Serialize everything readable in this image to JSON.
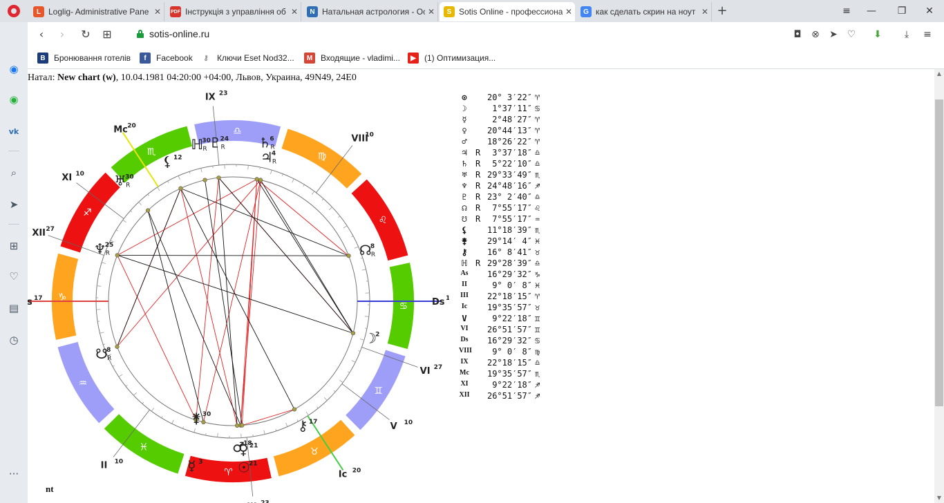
{
  "browser": {
    "tabs": [
      {
        "title": "Loglig- Administrative Pane",
        "favicon": "L",
        "color": "#e8572c"
      },
      {
        "title": "Інструкція з управління об",
        "favicon": "PDF",
        "color": "#d9342b"
      },
      {
        "title": "Натальная астрология - Ос",
        "favicon": "N",
        "color": "#2f6db5"
      },
      {
        "title": "Sotis Online - профессиона",
        "favicon": "S",
        "color": "#e6b800",
        "active": true
      },
      {
        "title": "как сделать скрин на ноут",
        "favicon": "G",
        "color": "#4285f4"
      }
    ],
    "url": "sotis-online.ru",
    "bookmarks": [
      {
        "label": "Бронювання готелів",
        "icon": "B",
        "color": "#1c3d7a"
      },
      {
        "label": "Facebook",
        "icon": "f",
        "color": "#3b5998"
      },
      {
        "label": "Ключи Eset Nod32...",
        "icon": "key",
        "color": "#888888"
      },
      {
        "label": "Входящие - vladimi...",
        "icon": "M",
        "color": "#d44638"
      },
      {
        "label": "(1) Оптимизация...",
        "icon": "yt",
        "color": "#e62117"
      }
    ]
  },
  "header": {
    "prefix": "Натал: ",
    "chart_name": "New chart (w)",
    "details": ", 10.04.1981 04:20:00 +04:00, Львов, Украина, 49N49, 24E0"
  },
  "wheel": {
    "houses": [
      {
        "label": "As",
        "deg": "17"
      },
      {
        "label": "II",
        "deg": "10"
      },
      {
        "label": "III",
        "deg": "23"
      },
      {
        "label": "Ic",
        "deg": "20"
      },
      {
        "label": "V",
        "deg": "10"
      },
      {
        "label": "VI",
        "deg": "27"
      },
      {
        "label": "Ds",
        "deg": "17"
      },
      {
        "label": "VIII",
        "deg": "10"
      },
      {
        "label": "IX",
        "deg": "23"
      },
      {
        "label": "Mc",
        "deg": "20"
      },
      {
        "label": "XI",
        "deg": "10"
      },
      {
        "label": "XII",
        "deg": "27"
      }
    ],
    "planets": [
      {
        "glyph": "☉",
        "deg": "21",
        "retro": ""
      },
      {
        "glyph": "☽",
        "deg": "2",
        "retro": ""
      },
      {
        "glyph": "☿",
        "deg": "3",
        "retro": ""
      },
      {
        "glyph": "♀",
        "deg": "21",
        "retro": ""
      },
      {
        "glyph": "♂",
        "deg": "18",
        "retro": ""
      },
      {
        "glyph": "♃",
        "deg": "4",
        "retro": "R"
      },
      {
        "glyph": "♄",
        "deg": "6",
        "retro": "R"
      },
      {
        "glyph": "♅",
        "deg": "30",
        "retro": "R"
      },
      {
        "glyph": "♆",
        "deg": "25",
        "retro": "R"
      },
      {
        "glyph": "♇",
        "deg": "24",
        "retro": "R"
      },
      {
        "glyph": "☊",
        "deg": "8",
        "retro": "R"
      },
      {
        "glyph": "☋",
        "deg": "8",
        "retro": "R"
      },
      {
        "glyph": "⚸",
        "deg": "12",
        "retro": ""
      },
      {
        "glyph": "⚵",
        "deg": "30",
        "retro": ""
      },
      {
        "glyph": "⚷",
        "deg": "17",
        "retro": ""
      },
      {
        "glyph": "ℍ",
        "deg": "30",
        "retro": "R"
      }
    ]
  },
  "table": [
    {
      "sym": "⊙",
      "rx": "",
      "deg": "20° 3′22″",
      "sign": "♈"
    },
    {
      "sym": "☽",
      "rx": "",
      "deg": "1°37′11″",
      "sign": "♋"
    },
    {
      "sym": "☿",
      "rx": "",
      "deg": "2°48′27″",
      "sign": "♈"
    },
    {
      "sym": "♀",
      "rx": "",
      "deg": "20°44′13″",
      "sign": "♈"
    },
    {
      "sym": "♂",
      "rx": "",
      "deg": "18°26′22″",
      "sign": "♈"
    },
    {
      "sym": "♃",
      "rx": "R",
      "deg": "3°37′18″",
      "sign": "♎"
    },
    {
      "sym": "♄",
      "rx": "R",
      "deg": "5°22′10″",
      "sign": "♎"
    },
    {
      "sym": "♅",
      "rx": "R",
      "deg": "29°33′49″",
      "sign": "♏"
    },
    {
      "sym": "♆",
      "rx": "R",
      "deg": "24°48′16″",
      "sign": "♐"
    },
    {
      "sym": "♇",
      "rx": "R",
      "deg": "23° 2′40″",
      "sign": "♎"
    },
    {
      "sym": "☊",
      "rx": "R",
      "deg": "7°55′17″",
      "sign": "♌"
    },
    {
      "sym": "☋",
      "rx": "R",
      "deg": "7°55′17″",
      "sign": "♒"
    },
    {
      "sym": "⚸",
      "rx": "",
      "deg": "11°18′39″",
      "sign": "♏"
    },
    {
      "sym": "⚵",
      "rx": "",
      "deg": "29°14′ 4″",
      "sign": "♓"
    },
    {
      "sym": "⚷",
      "rx": "",
      "deg": "16° 8′41″",
      "sign": "♉"
    },
    {
      "sym": "ℍ",
      "rx": "R",
      "deg": "29°28′39″",
      "sign": "♎"
    },
    {
      "sym": "As",
      "rx": "",
      "deg": "16°29′32″",
      "sign": "♑"
    },
    {
      "sym": "II",
      "rx": "",
      "deg": "9° 0′ 8″",
      "sign": "♓"
    },
    {
      "sym": "III",
      "rx": "",
      "deg": "22°18′15″",
      "sign": "♈"
    },
    {
      "sym": "Ic",
      "rx": "",
      "deg": "19°35′57″",
      "sign": "♉"
    },
    {
      "sym": "V",
      "rx": "",
      "deg": "9°22′18″",
      "sign": "♊"
    },
    {
      "sym": "VI",
      "rx": "",
      "deg": "26°51′57″",
      "sign": "♊"
    },
    {
      "sym": "Ds",
      "rx": "",
      "deg": "16°29′32″",
      "sign": "♋"
    },
    {
      "sym": "VIII",
      "rx": "",
      "deg": "9° 0′ 8″",
      "sign": "♍"
    },
    {
      "sym": "IX",
      "rx": "",
      "deg": "22°18′15″",
      "sign": "♎"
    },
    {
      "sym": "Mc",
      "rx": "",
      "deg": "19°35′57″",
      "sign": "♏"
    },
    {
      "sym": "XI",
      "rx": "",
      "deg": "9°22′18″",
      "sign": "♐"
    },
    {
      "sym": "XII",
      "rx": "",
      "deg": "26°51′57″",
      "sign": "♐"
    }
  ],
  "footer_text": "nt",
  "colors": {
    "fire": "#ee1111",
    "earth": "#ffa41f",
    "air": "#9e9ef8",
    "water": "#55cc00",
    "aspect_red": "#e02020",
    "aspect_black": "#111111",
    "axis_red": "#e04040",
    "axis_blue": "#3a3ad8"
  }
}
